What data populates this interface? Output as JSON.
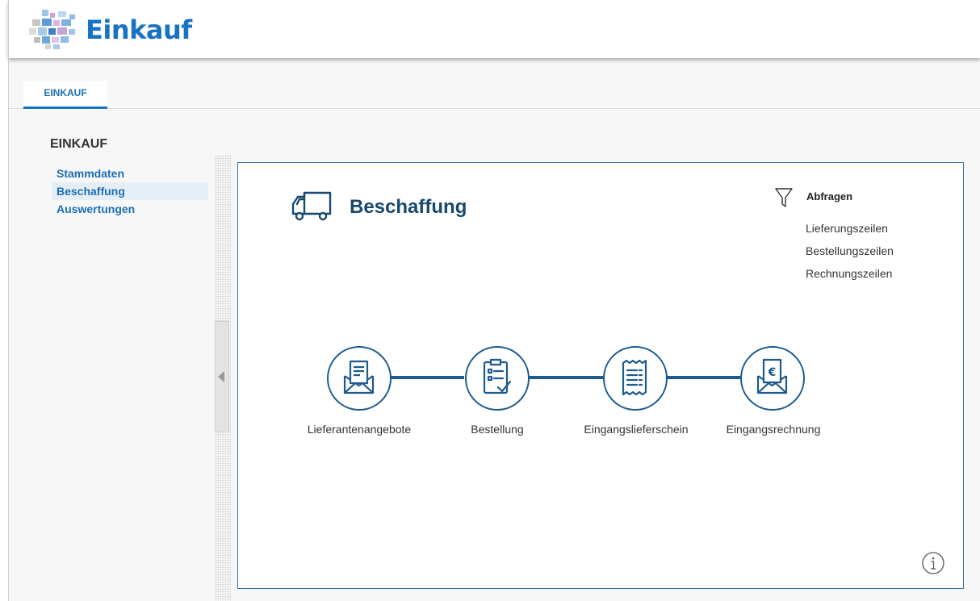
{
  "app": {
    "title": "Einkauf"
  },
  "tabs": [
    {
      "label": "EINKAUF"
    }
  ],
  "sidebar": {
    "title": "EINKAUF",
    "items": [
      {
        "label": "Stammdaten"
      },
      {
        "label": "Beschaffung"
      },
      {
        "label": "Auswertungen"
      }
    ]
  },
  "panel": {
    "title": "Beschaffung",
    "queries": {
      "title": "Abfragen",
      "items": [
        {
          "label": "Lieferungszeilen"
        },
        {
          "label": "Bestellungszeilen"
        },
        {
          "label": "Rechnungszeilen"
        }
      ]
    },
    "steps": [
      {
        "label": "Lieferantenangebote",
        "icon": "envelope-letter-icon"
      },
      {
        "label": "Bestellung",
        "icon": "clipboard-check-icon"
      },
      {
        "label": "Eingangslieferschein",
        "icon": "receipt-icon"
      },
      {
        "label": "Eingangsrechnung",
        "icon": "envelope-euro-icon"
      }
    ]
  },
  "colors": {
    "accent": "#1a73c2",
    "link": "#1a6fb5",
    "flow": "#1d5a8e",
    "title": "#17486e"
  }
}
